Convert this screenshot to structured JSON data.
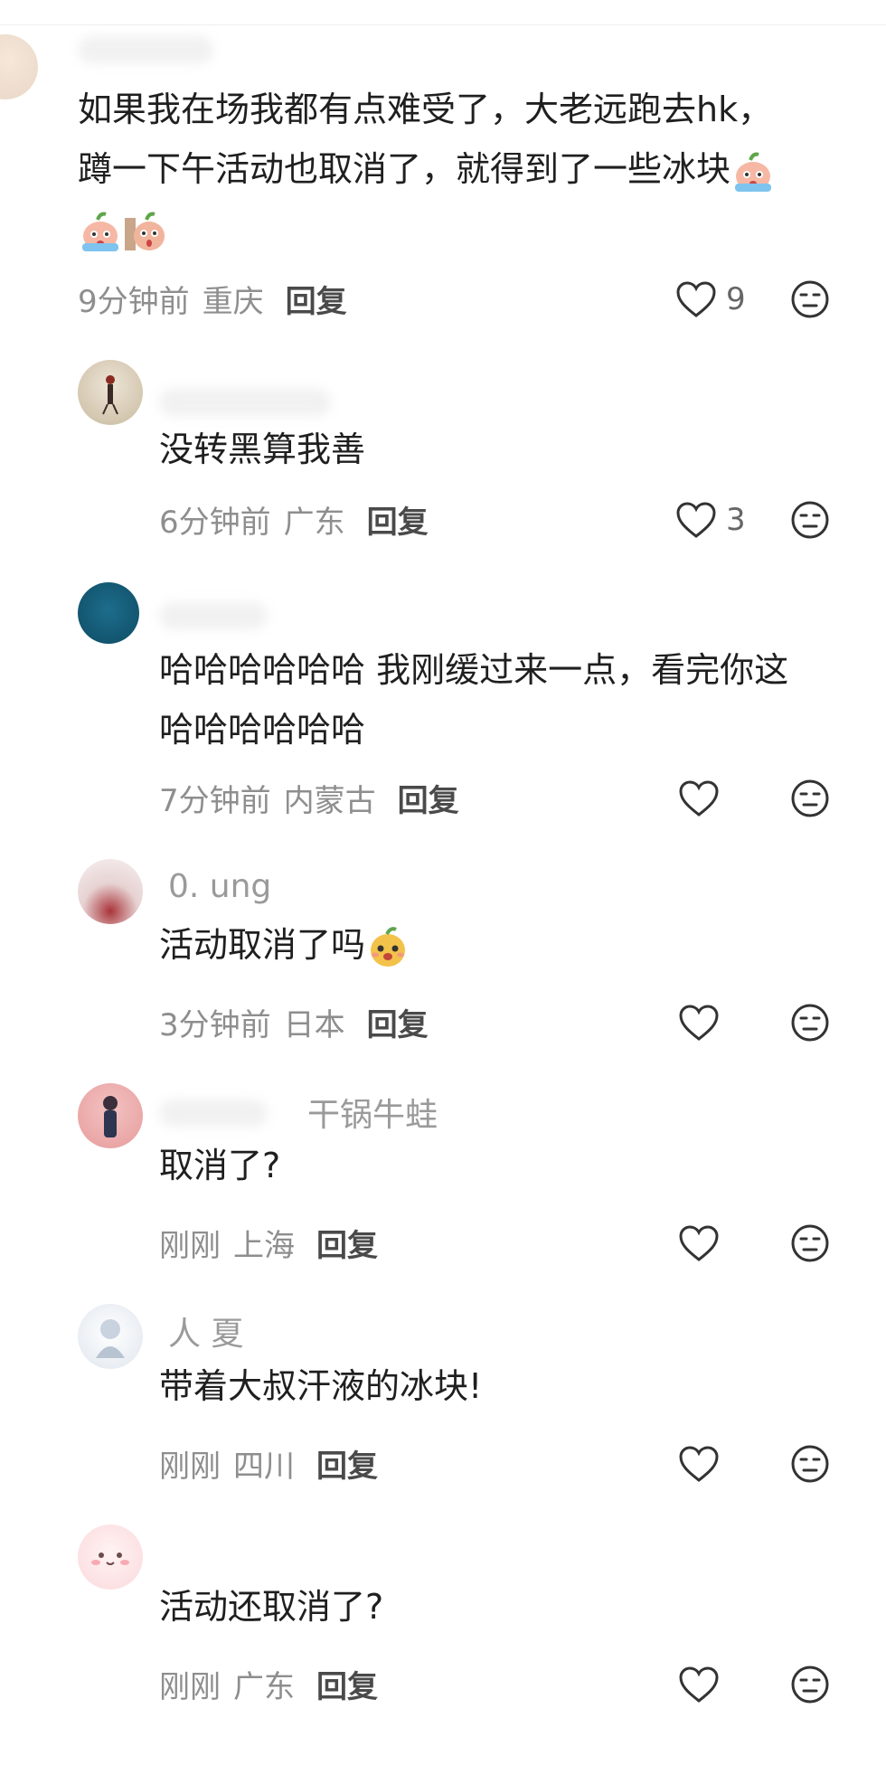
{
  "comments": [
    {
      "username": "",
      "lines": [
        "如果我在场我都有点难受了，大老远跑去hk，",
        "蹲一下午活动也取消了，就得到了一些冰块"
      ],
      "time": "9分钟前",
      "location": "重庆",
      "reply_label": "回复",
      "likes": "9"
    },
    {
      "username": "",
      "lines": [
        "没转黑算我善"
      ],
      "time": "6分钟前",
      "location": "广东",
      "reply_label": "回复",
      "likes": "3"
    },
    {
      "username": "",
      "lines": [
        "哈哈哈哈哈哈 我刚缓过来一点，看完你这",
        "哈哈哈哈哈哈"
      ],
      "time": "7分钟前",
      "location": "内蒙古",
      "reply_label": "回复",
      "likes": ""
    },
    {
      "username": "0.      ung",
      "lines": [
        "活动取消了吗"
      ],
      "time": "3分钟前",
      "location": "日本",
      "reply_label": "回复",
      "likes": ""
    },
    {
      "username": "干锅牛蛙",
      "lines": [
        "取消了?"
      ],
      "time": "刚刚",
      "location": "上海",
      "reply_label": "回复",
      "likes": ""
    },
    {
      "username": "人      夏",
      "lines": [
        "带着大叔汗液的冰块!"
      ],
      "time": "刚刚",
      "location": "四川",
      "reply_label": "回复",
      "likes": ""
    },
    {
      "username": "",
      "lines": [
        "活动还取消了?"
      ],
      "time": "刚刚",
      "location": "广东",
      "reply_label": "回复",
      "likes": ""
    }
  ],
  "icons": {
    "like": "heart-outline-icon",
    "dislike": "meh-face-icon",
    "emoji": "crying-peach-emoji"
  }
}
